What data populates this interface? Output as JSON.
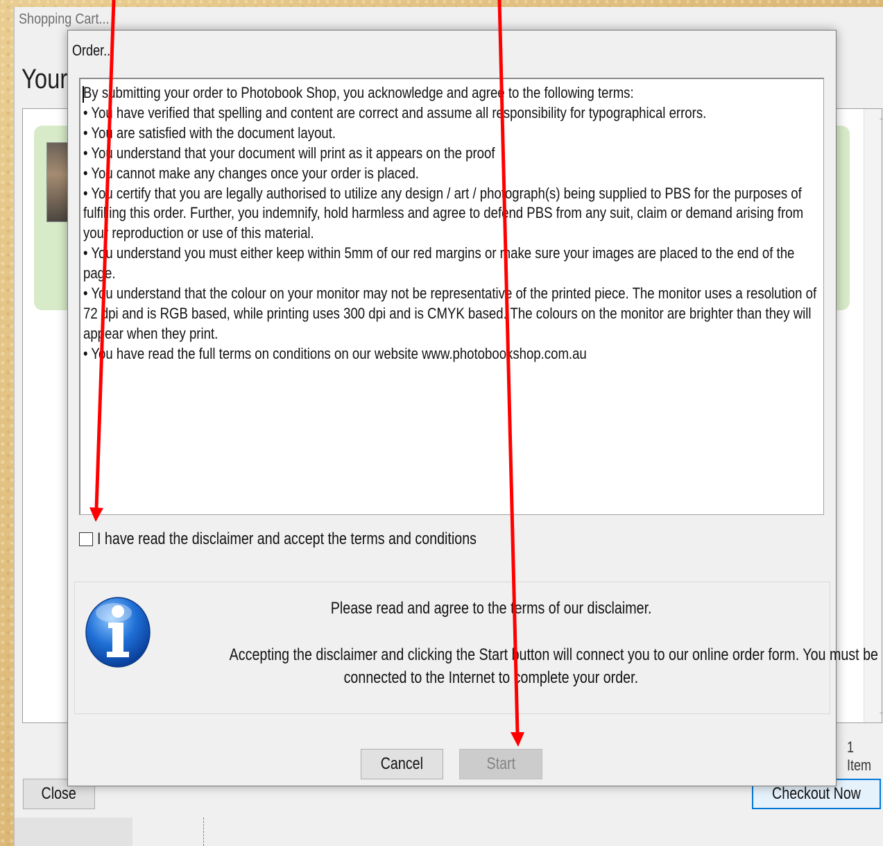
{
  "cart_window": {
    "title": "Shopping Cart...",
    "heading": "Your",
    "item_count": "1 Item",
    "close_label": "Close",
    "checkout_label": "Checkout Now"
  },
  "dialog": {
    "title": "Order...",
    "terms": [
      "By submitting your order to Photobook Shop, you acknowledge and agree to the following terms:",
      "• You have verified that spelling and content are correct and assume all responsibility for typographical errors.",
      "• You are satisfied with the document layout.",
      "• You understand that your document will print as it appears on the proof",
      "• You cannot make any changes once your order is placed.",
      "• You certify that you are legally authorised to utilize any design / art / photograph(s) being supplied to PBS for the purposes of",
      "fulfilling this order. Further, you indemnify, hold harmless and agree to defend PBS from any suit, claim or demand arising from",
      "your reproduction or use of this material.",
      "• You understand you must either keep within 5mm of our red margins or make sure your images are placed to the end of the",
      "page.",
      "• You understand that the colour on your monitor may not be representative of the printed piece. The monitor uses a resolution of",
      "72 dpi and is RGB based, while printing uses 300 dpi and is CMYK based. The colours on the monitor are brighter than they will",
      "appear when they print.",
      "• You have read the full terms on conditions on our website www.photobookshop.com.au"
    ],
    "accept_checkbox": {
      "label": "I have read the disclaimer and accept the terms and conditions",
      "checked": false
    },
    "info": {
      "icon": "info-icon",
      "line1": "Please read and agree to the terms of our disclaimer.",
      "line2a": "Accepting the disclaimer and clicking the Start button will connect you to our online order form. You must be",
      "line2b": "connected to the Internet to complete your order."
    },
    "cancel_label": "Cancel",
    "start_label": "Start",
    "start_enabled": false
  },
  "annotation_color": "#ff0000"
}
